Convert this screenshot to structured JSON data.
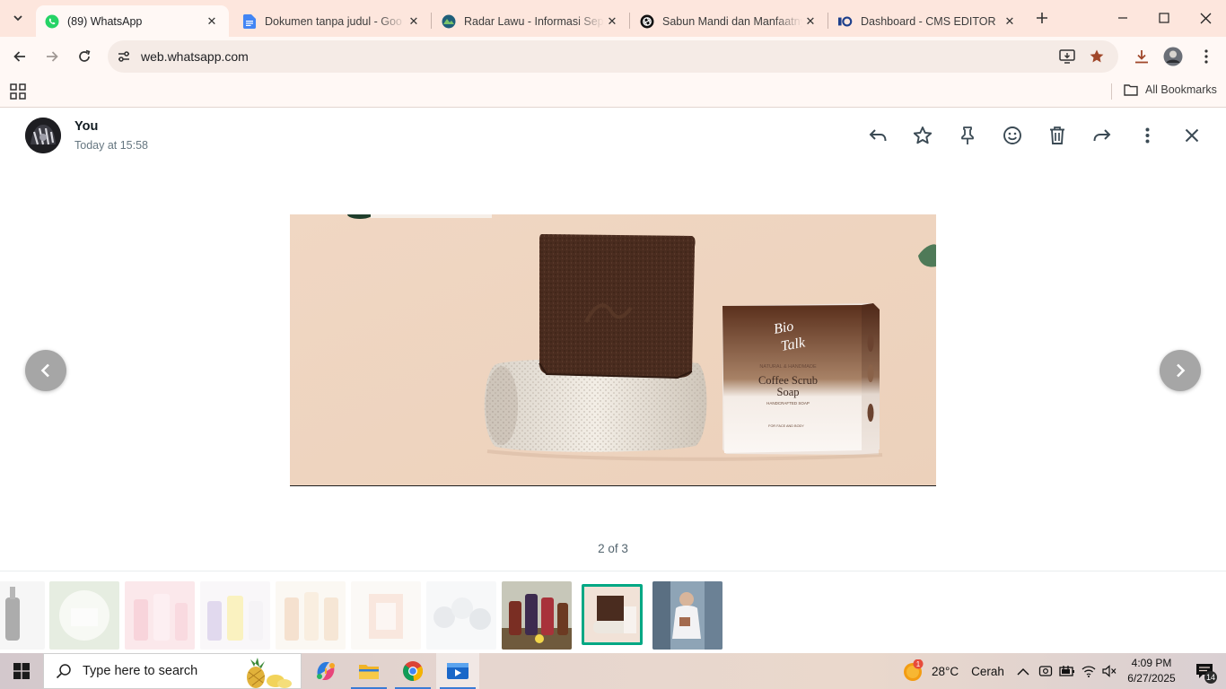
{
  "browser": {
    "tabs": [
      {
        "title": "(89) WhatsApp",
        "active": true
      },
      {
        "title": "Dokumen tanpa judul - Goo"
      },
      {
        "title": "Radar Lawu - Informasi Sepu"
      },
      {
        "title": "Sabun Mandi dan Manfaatny"
      },
      {
        "title": "Dashboard - CMS EDITOR"
      }
    ],
    "url": "web.whatsapp.com",
    "bookmarks": {
      "all_label": "All Bookmarks"
    }
  },
  "viewer": {
    "sender": "You",
    "timestamp": "Today at 15:58",
    "counter": "2 of 3",
    "actions": [
      "reply",
      "star",
      "pin",
      "react",
      "delete",
      "forward",
      "more",
      "close"
    ]
  },
  "media": {
    "brand_line1": "Bio",
    "brand_line2": "Talk",
    "box_subtitle": "NATURAL & HANDMADE",
    "box_title_line1": "Coffee Scrub",
    "box_title_line2": "Soap",
    "box_tagline": "HANDCRAFTED SOAP",
    "box_usage": "FOR FACE AND BODY"
  },
  "taskbar": {
    "search_placeholder": "Type here to search",
    "weather_temp": "28°C",
    "weather_condition": "Cerah",
    "weather_badge": "1",
    "time": "4:09 PM",
    "date": "6/27/2025",
    "notification_count": "14"
  },
  "colors": {
    "tab_strip": "#fde6dd",
    "toolbar": "#fff8f5",
    "selected_thumb": "#00a884",
    "whatsapp_green": "#25d366"
  }
}
